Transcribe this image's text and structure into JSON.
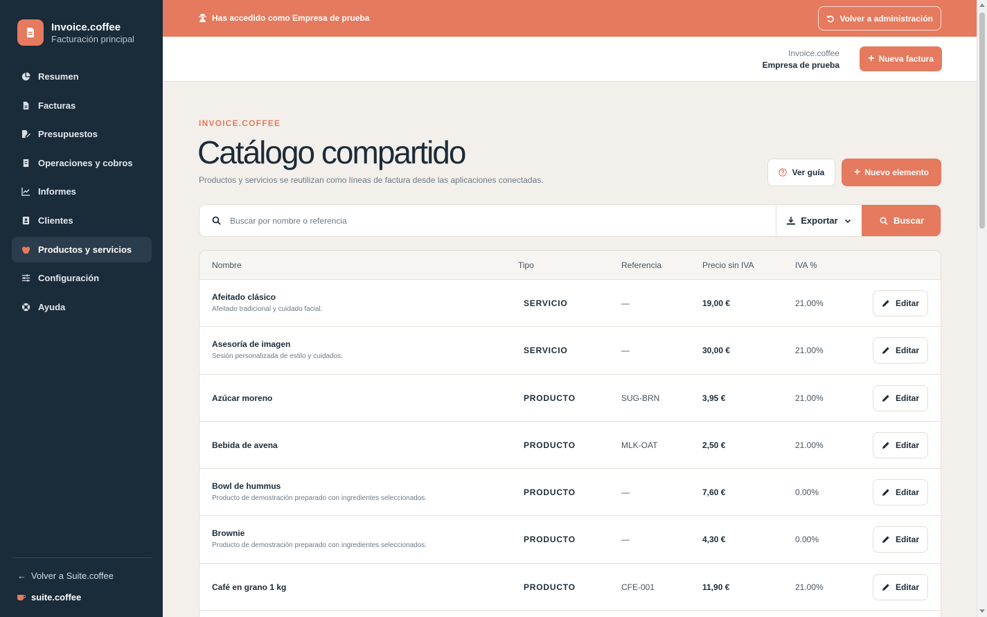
{
  "sidebar": {
    "brand_name": "Invoice.coffee",
    "brand_sub": "Facturación principal",
    "items": [
      {
        "label": "Resumen",
        "icon": "pie-chart-icon"
      },
      {
        "label": "Facturas",
        "icon": "file-icon"
      },
      {
        "label": "Presupuestos",
        "icon": "file-signature-icon"
      },
      {
        "label": "Operaciones y cobros",
        "icon": "receipt-icon"
      },
      {
        "label": "Informes",
        "icon": "chart-line-icon"
      },
      {
        "label": "Clientes",
        "icon": "contact-book-icon"
      },
      {
        "label": "Productos y servicios",
        "icon": "box-icon",
        "active": true
      },
      {
        "label": "Configuración",
        "icon": "sliders-icon"
      },
      {
        "label": "Ayuda",
        "icon": "lifebuoy-icon"
      }
    ],
    "back_link": "Volver a Suite.coffee",
    "suite_brand": "suite.coffee"
  },
  "banner": {
    "text": "Has accedido como Empresa de prueba",
    "button": "Volver a administración"
  },
  "header": {
    "app": "Invoice.coffee",
    "company": "Empresa de prueba",
    "new_invoice": "Nueva factura"
  },
  "page": {
    "eyebrow": "INVOICE.COFFEE",
    "title": "Catálogo compartido",
    "subtitle": "Productos y servicios se reutilizan como líneas de factura desde las aplicaciones conectadas.",
    "guide_button": "Ver guía",
    "new_button": "Nuevo elemento"
  },
  "search": {
    "placeholder": "Buscar por nombre o referencia",
    "export": "Exportar",
    "button": "Buscar"
  },
  "table": {
    "headers": {
      "name": "Nombre",
      "type": "Tipo",
      "ref": "Referencia",
      "price": "Precio sin IVA",
      "iva": "IVA %"
    },
    "edit_label": "Editar",
    "rows": [
      {
        "name": "Afeitado clásico",
        "desc": "Afeitado tradicional y cuidado facial.",
        "type": "SERVICIO",
        "ref": "—",
        "price": "19,00 €",
        "iva": "21.00%"
      },
      {
        "name": "Asesoría de imagen",
        "desc": "Sesión personalizada de estilo y cuidados.",
        "type": "SERVICIO",
        "ref": "—",
        "price": "30,00 €",
        "iva": "21.00%"
      },
      {
        "name": "Azúcar moreno",
        "desc": "",
        "type": "PRODUCTO",
        "ref": "SUG-BRN",
        "price": "3,95 €",
        "iva": "21.00%"
      },
      {
        "name": "Bebida de avena",
        "desc": "",
        "type": "PRODUCTO",
        "ref": "MLK-OAT",
        "price": "2,50 €",
        "iva": "21.00%"
      },
      {
        "name": "Bowl de hummus",
        "desc": "Producto de demostración preparado con ingredientes seleccionados.",
        "type": "PRODUCTO",
        "ref": "—",
        "price": "7,60 €",
        "iva": "0.00%"
      },
      {
        "name": "Brownie",
        "desc": "Producto de demostración preparado con ingredientes seleccionados.",
        "type": "PRODUCTO",
        "ref": "—",
        "price": "4,30 €",
        "iva": "0.00%"
      },
      {
        "name": "Café en grano 1 kg",
        "desc": "",
        "type": "PRODUCTO",
        "ref": "CFE-001",
        "price": "11,90 €",
        "iva": "21.00%"
      }
    ]
  },
  "colors": {
    "accent": "#e57a5e",
    "sidebar": "#1a2b39",
    "background": "#f3f0eb"
  }
}
